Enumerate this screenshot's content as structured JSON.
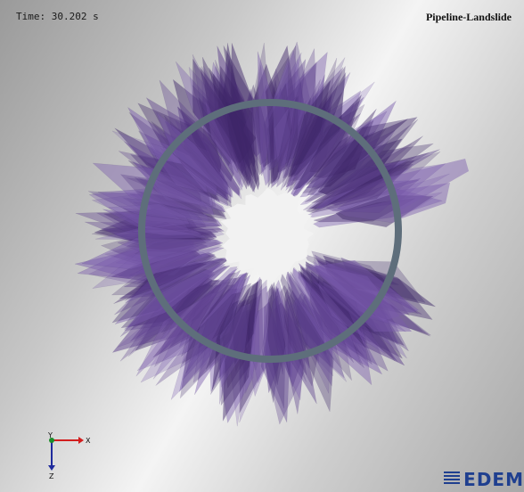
{
  "header": {
    "time_label": "Time:",
    "time_value": "30.202",
    "time_unit": "s",
    "title": "Pipeline-Landslide"
  },
  "scene": {
    "particle_color": "#5b3e8c",
    "particle_color_dark": "#3e2668",
    "particle_color_light": "#7a5cae",
    "pipe_color": "#5e6e7b"
  },
  "axes": {
    "x_label": "X",
    "y_label": "Y",
    "z_label": "Z",
    "x_color": "#d21e1e",
    "y_color": "#1c8c2a",
    "z_color": "#1e2a9c"
  },
  "logo": {
    "text": "EDEM"
  }
}
